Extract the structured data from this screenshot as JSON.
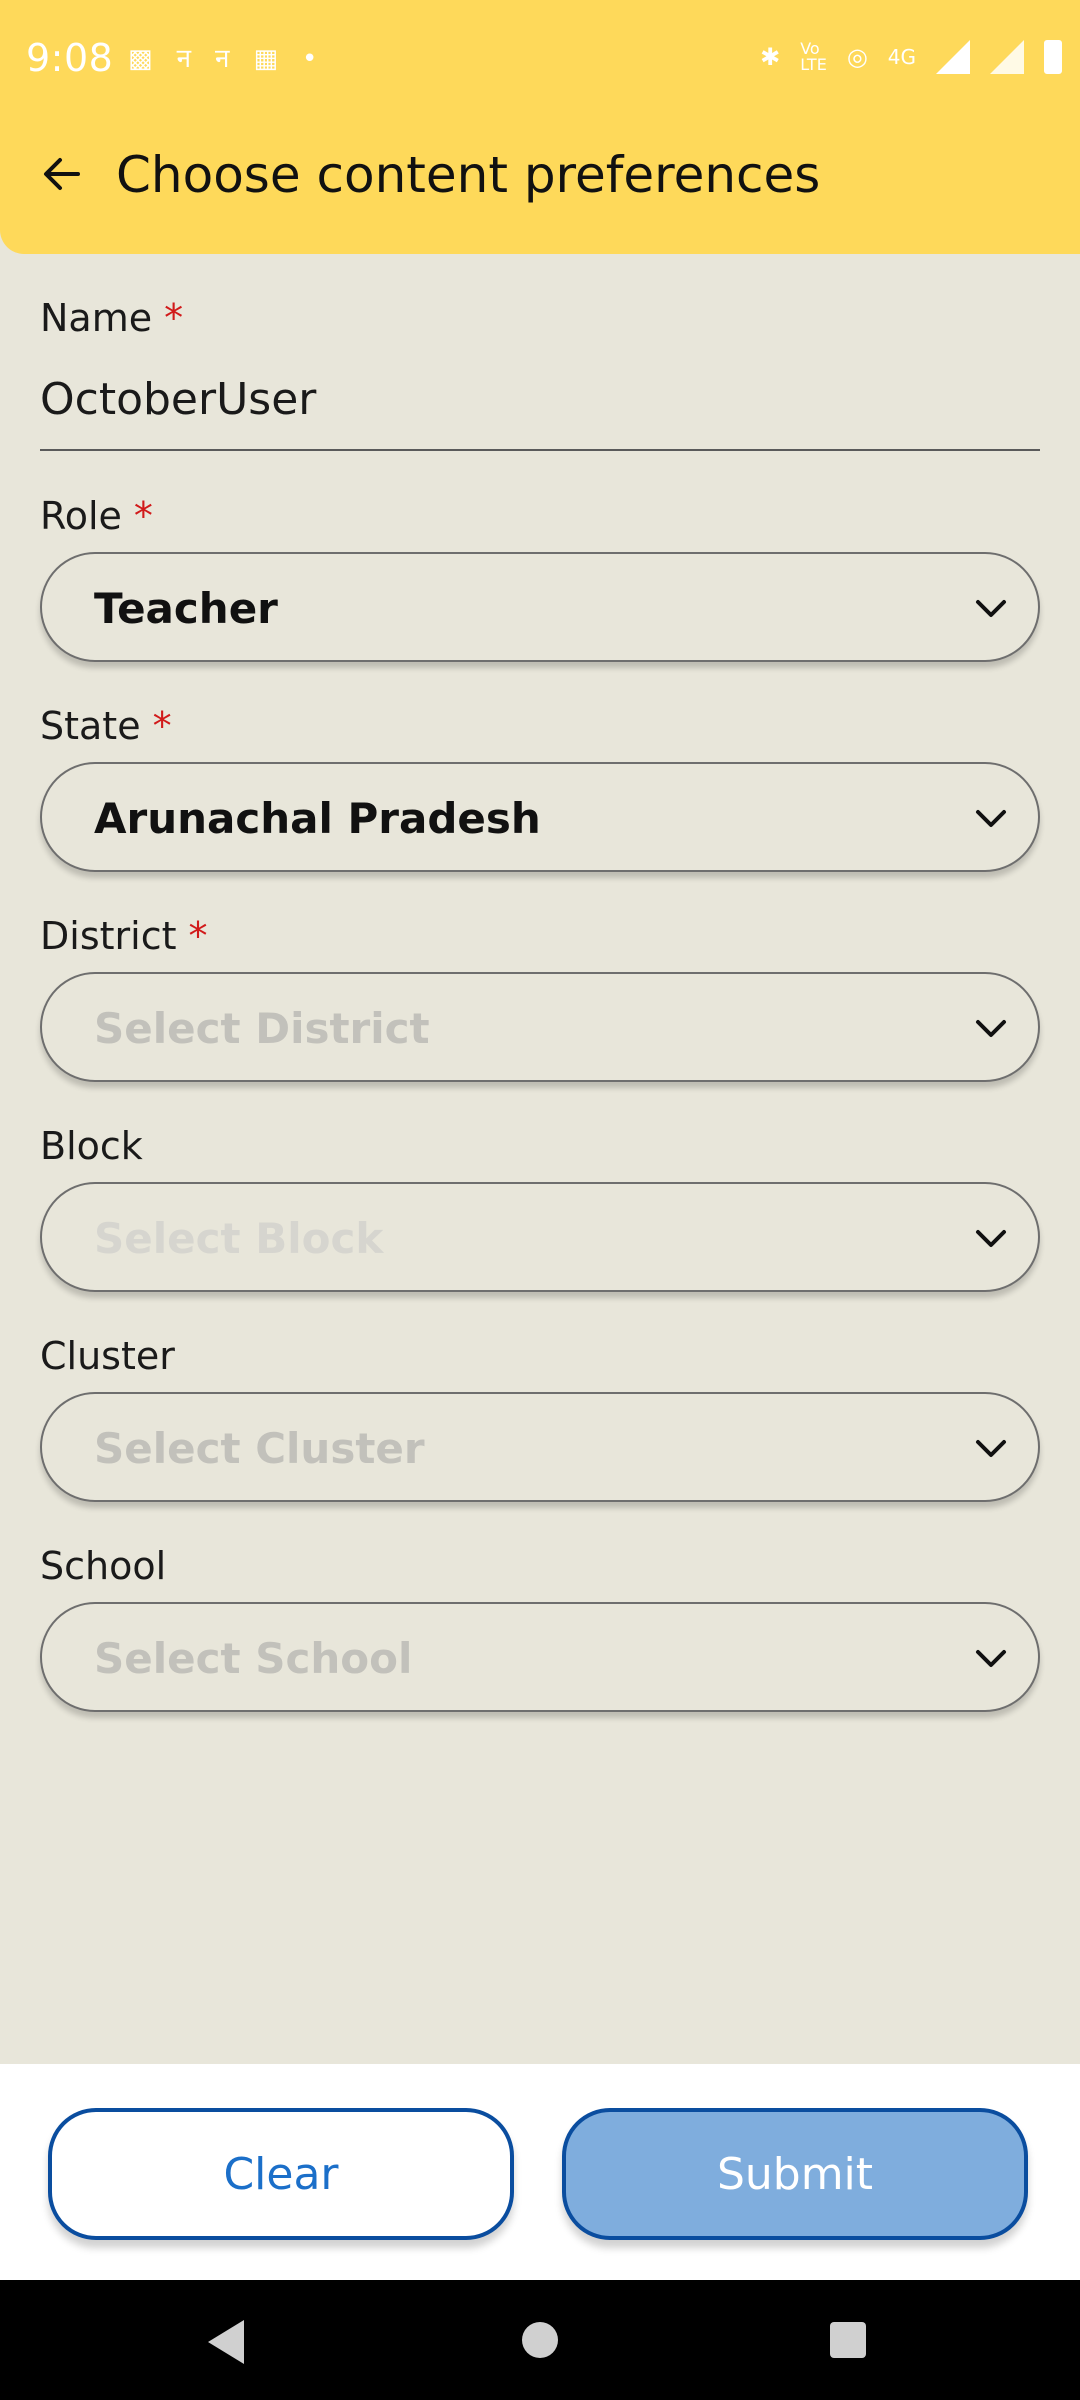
{
  "status_bar": {
    "time": "9:08",
    "left_icons": [
      "sim-icon",
      "notification-icon",
      "notification-icon",
      "calendar-icon",
      "dot-icon"
    ],
    "right_icons": [
      "bluetooth-icon",
      "volte-icon",
      "hotspot-icon",
      "4g-icon",
      "signal-icon",
      "signal-icon",
      "battery-icon"
    ],
    "network_label": "4G"
  },
  "app_bar": {
    "title": "Choose content preferences"
  },
  "form": {
    "name": {
      "label": "Name",
      "required": "*",
      "value": "OctoberUser"
    },
    "role": {
      "label": "Role",
      "required": "*",
      "value": "Teacher"
    },
    "state": {
      "label": "State",
      "required": "*",
      "value": "Arunachal Pradesh"
    },
    "district": {
      "label": "District",
      "required": "*",
      "placeholder": "Select District"
    },
    "block": {
      "label": "Block",
      "placeholder": "Select Block"
    },
    "cluster": {
      "label": "Cluster",
      "placeholder": "Select Cluster"
    },
    "school": {
      "label": "School",
      "placeholder": "Select School"
    }
  },
  "actions": {
    "clear_label": "Clear",
    "submit_label": "Submit"
  },
  "colors": {
    "header": "#fed95a",
    "background": "#e8e6da",
    "required": "#d11a1a",
    "primary_border": "#0a4d9f",
    "submit_fill": "#7faddd",
    "clear_text": "#1b6fc9"
  }
}
